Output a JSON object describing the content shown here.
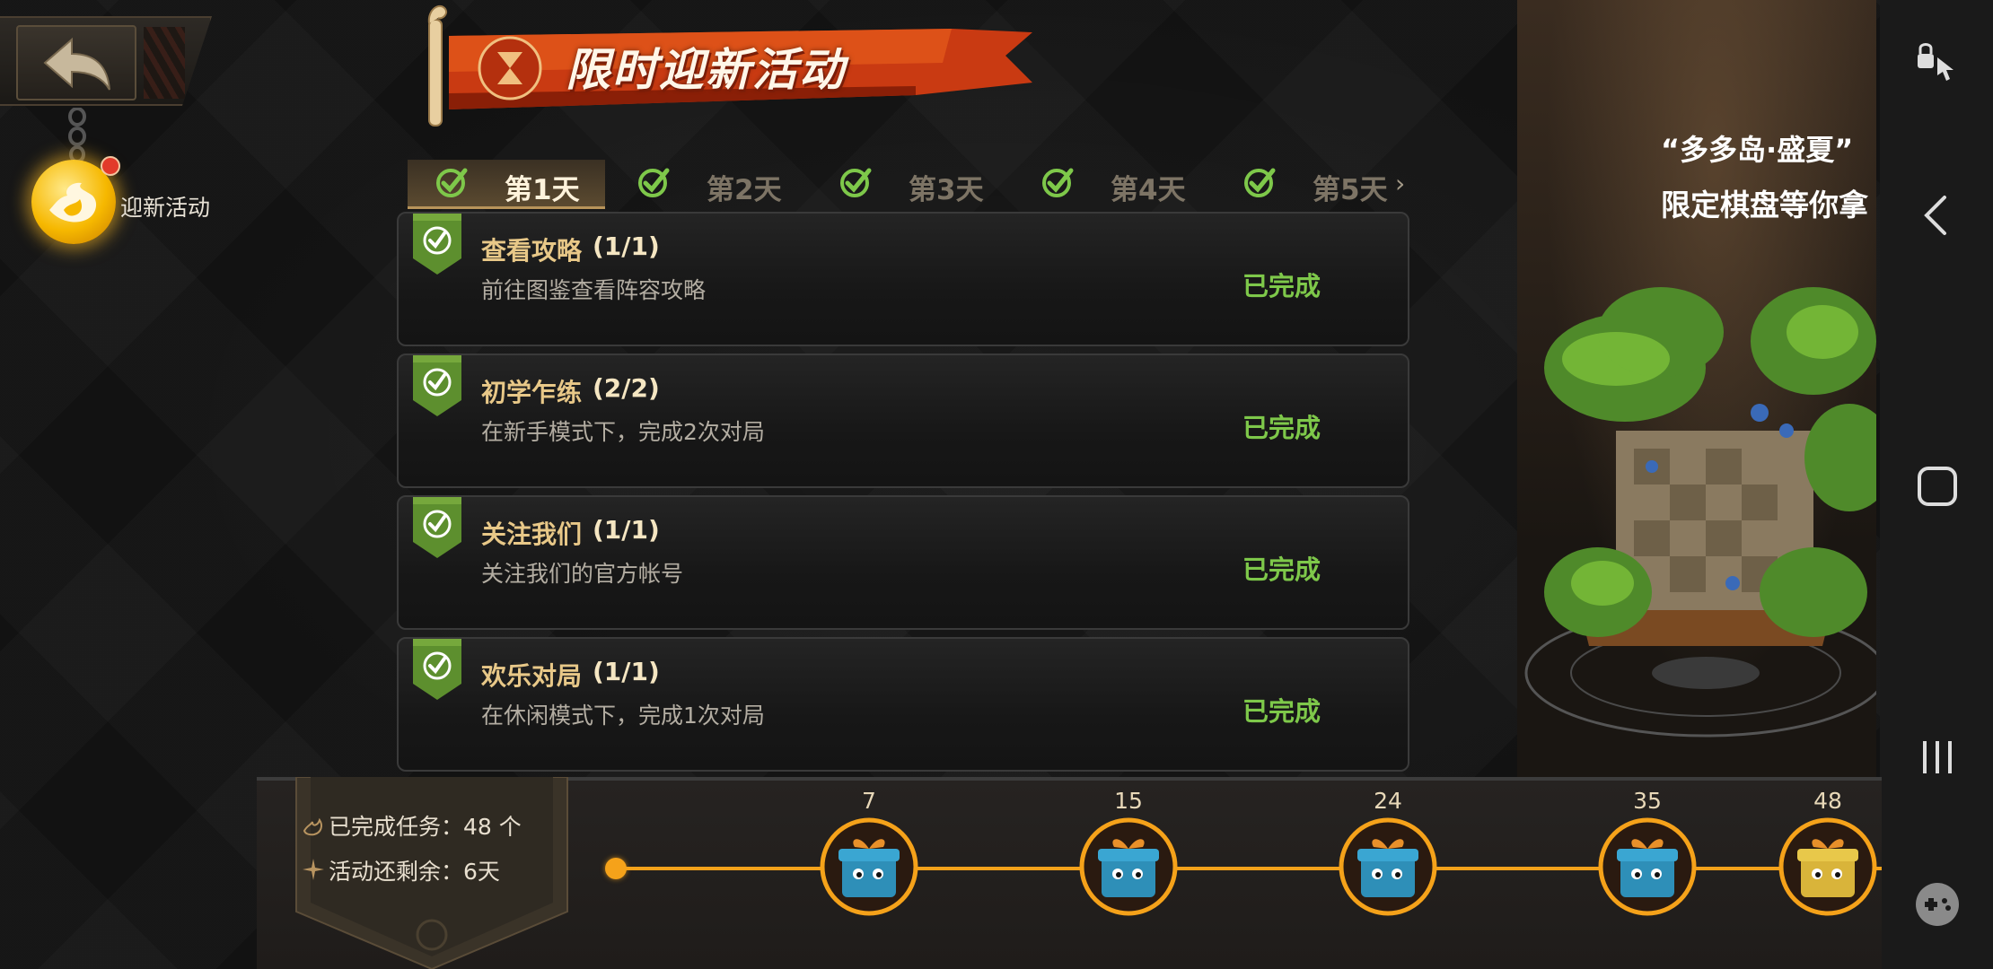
{
  "banner": {
    "title": "限时迎新活动"
  },
  "side": {
    "activity_label": "迎新活动"
  },
  "tabs": [
    {
      "label": "第1天"
    },
    {
      "label": "第2天"
    },
    {
      "label": "第3天"
    },
    {
      "label": "第4天"
    },
    {
      "label": "第5天"
    }
  ],
  "tasks": [
    {
      "name": "查看攻略",
      "progress": "(1/1)",
      "desc": "前往图鉴查看阵容攻略",
      "status": "已完成"
    },
    {
      "name": "初学乍练",
      "progress": "(2/2)",
      "desc": "在新手模式下，完成2次对局",
      "status": "已完成"
    },
    {
      "name": "关注我们",
      "progress": "(1/1)",
      "desc": "关注我们的官方帐号",
      "status": "已完成"
    },
    {
      "name": "欢乐对局",
      "progress": "(1/1)",
      "desc": "在休闲模式下，完成1次对局",
      "status": "已完成"
    }
  ],
  "promo": {
    "line1": "“多多岛·盛夏”",
    "line2": "限定棋盘等你拿"
  },
  "stats": {
    "completed": "已完成任务：48 个",
    "remaining": "活动还剩余：6天"
  },
  "milestones": [
    "7",
    "15",
    "24",
    "35",
    "48"
  ],
  "colors": {
    "accent": "#f5a21a",
    "done": "#7ec84a",
    "gold_text": "#e8c888"
  }
}
